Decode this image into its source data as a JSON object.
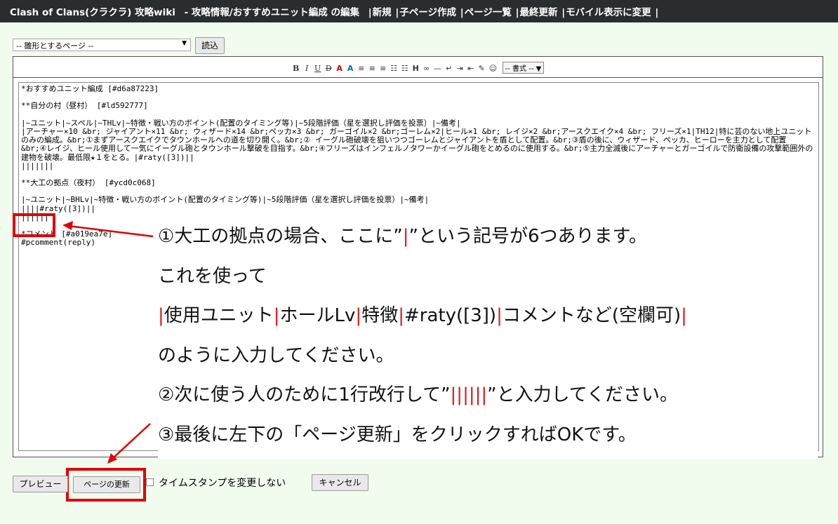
{
  "header": {
    "site_title": "Clash of Clans(クラクラ) 攻略wiki",
    "page_title": "-  攻略情報/おすすめユニット編成 の編集",
    "links": [
      "新規",
      "子ページ作成",
      "ページ一覧",
      "最終更新",
      "モバイル表示に変更"
    ]
  },
  "template": {
    "select_value": "-- 雛形とするページ --",
    "load_label": "読込"
  },
  "toolbar": {
    "icons": [
      "B",
      "I",
      "U",
      "D",
      "A",
      "A",
      "≡",
      "≡",
      "≡",
      "☷",
      "☷",
      "H",
      "∞",
      "—",
      "↵",
      "⇥",
      "⇤",
      "✎",
      "☺"
    ],
    "format_select": "-- 書式 --"
  },
  "editor": {
    "lines": [
      "*おすすめユニット編成 [#d6a87223]",
      "",
      "**自分の村（昼村） [#ld592777]",
      "",
      "|~ユニット|~スペル|~THLv|~特徴・戦い方のポイント(配置のタイミング等)|~5段階評価（星を選択し評価を投票）|~備考|",
      "|アーチャー×10 &br; ジャイアント×11 &br; ウィザード×14 &br;ペッカ×3 &br; ガーゴイル×2 &br;ゴーレム×2|ヒール×1 &br; レイジ×2 &br;アースクエイク×4 &br; フリーズ×1|TH12|特に芸のない地上ユニットのみの編成。&br;①まずアースクエイクでタウンホールへの道を切り開く。&br;② イーグル砲破壊を狙いつつゴーレムとジャイアントを盾として配置。&br;③盾の後に、ウィザード、ペッカ、ヒーローを主力として配置　&br;④レイジ、ヒール使用して一気にイーグル砲とタウンホール撃破を目指す。&br;④フリーズはインフェルノタワーかイーグル砲をとめるのに使用する。&br;⑤主力全滅後にアーチャーとガーゴイルで防衛設備の攻撃範囲外の建物を破壊。最低限★１をとる。|#raty([3])||",
      "|||||||",
      "",
      "**大工の拠点（夜村） [#ycd0c068]",
      "",
      "|~ユニット|~BHLv|~特徴・戦い方のポイント(配置のタイミング等)|~5段階評価（星を選択し評価を投票）|~備考|",
      "||||#raty([3])||",
      "||||||",
      "",
      "*コメント [#a019ea7e]",
      "#pcomment(reply)"
    ]
  },
  "annotation": {
    "line1_a": "①大工の拠点の場合、ここに”",
    "line1_red": "|",
    "line1_b": "”という記号が6つあります。",
    "line2": "これを使って",
    "line3_p1": "|",
    "line3_t1": "使用ユニット",
    "line3_p2": "|",
    "line3_t2": "ホールLv",
    "line3_p3": "|",
    "line3_t3": "特徴",
    "line3_p4": "|",
    "line3_t4": "#raty([3])",
    "line3_p5": "|",
    "line3_t5": "コメントなど(空欄可)",
    "line3_p6": "|",
    "line4": "のように入力してください。",
    "line5_a": "②次に使う人のために1行改行して”",
    "line5_red": "||||||",
    "line5_b": "”と入力してください。",
    "line6": "③最後に左下の「ページ更新」をクリックすればOKです。"
  },
  "footer": {
    "preview_label": "プレビュー",
    "update_label": "ページの更新",
    "timestamp_label": "タイムスタンプを変更しない",
    "cancel_label": "キャンセル"
  },
  "colors": {
    "accent_red": "#e00000",
    "header_bg": "#2a2d30",
    "page_bg": "#f1fbee"
  }
}
